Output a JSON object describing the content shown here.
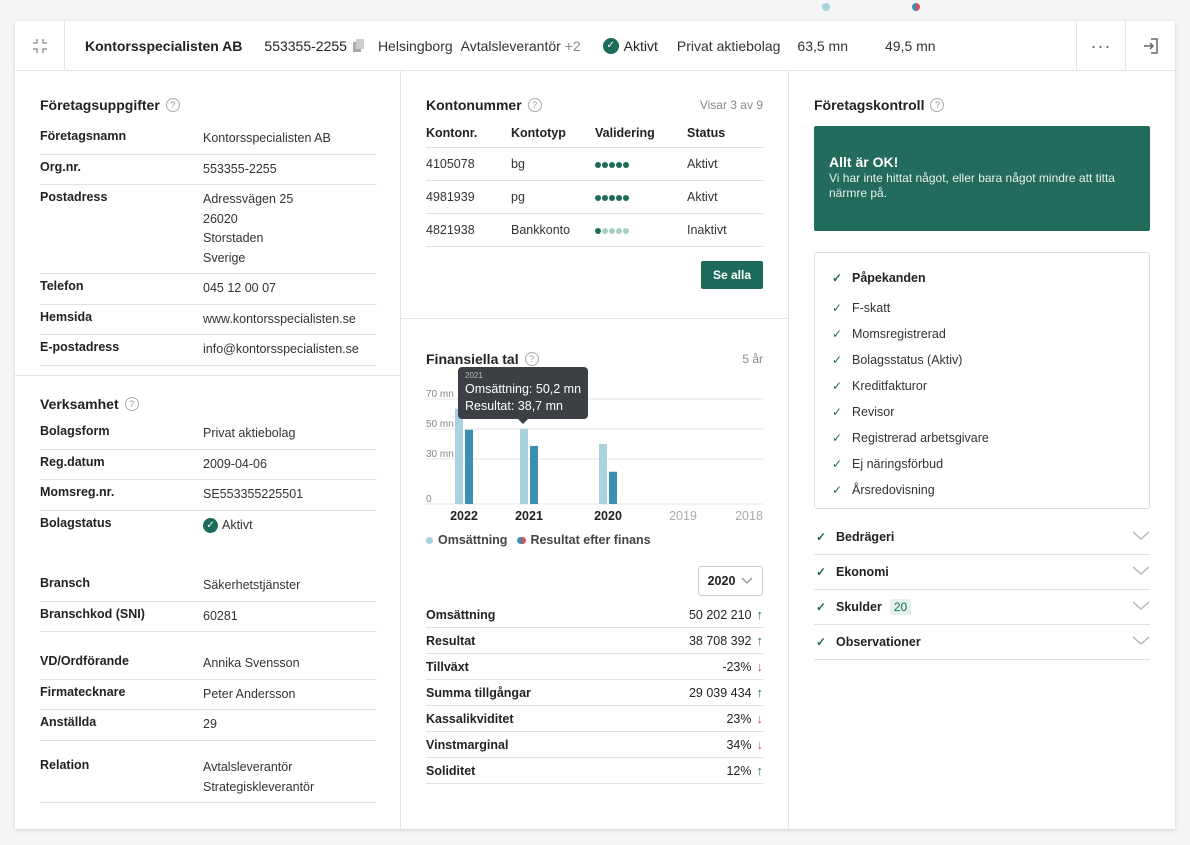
{
  "header": {
    "company_name": "Kontorsspecialisten AB",
    "org_nr": "553355-2255",
    "city": "Helsingborg",
    "relation": "Avtalsleverantör",
    "relation_more": "+2",
    "status": "Aktivt",
    "company_form": "Privat aktiebolag",
    "revenue": "63,5 mn",
    "result": "49,5 mn"
  },
  "colors": {
    "brand": "#1d6b5a",
    "revenue_bar": "#a9d1de",
    "result_bar": "#3a8fb4",
    "negative": "#d0545f"
  },
  "company_info": {
    "title": "Företagsuppgifter",
    "rows": [
      {
        "k": "Företagsnamn",
        "v": "Kontorsspecialisten AB"
      },
      {
        "k": "Org.nr.",
        "v": "553355-2255"
      },
      {
        "k": "Postadress",
        "v": "Adressvägen 25\n26020\nStorstaden\nSverige"
      },
      {
        "k": "Telefon",
        "v": "045 12 00 07"
      },
      {
        "k": "Hemsida",
        "v": "www.kontorsspecialisten.se"
      },
      {
        "k": "E-postadress",
        "v": "info@kontorsspecialisten.se"
      }
    ]
  },
  "business": {
    "title": "Verksamhet",
    "rows_a": [
      {
        "k": "Bolagsform",
        "v": "Privat aktiebolag"
      },
      {
        "k": "Reg.datum",
        "v": "2009-04-06"
      },
      {
        "k": "Momsreg.nr.",
        "v": "SE553355225501"
      },
      {
        "k": "Bolagstatus",
        "v": "Aktivt"
      }
    ],
    "rows_b": [
      {
        "k": "Bransch",
        "v": "Säkerhetstjänster"
      },
      {
        "k": "Branschkod (SNI)",
        "v": "60281"
      }
    ],
    "rows_c": [
      {
        "k": "VD/Ordförande",
        "v": "Annika Svensson"
      },
      {
        "k": "Firmatecknare",
        "v": "Peter Andersson"
      },
      {
        "k": "Anställda",
        "v": "29"
      }
    ],
    "rows_d": [
      {
        "k": "Relation",
        "v": "Avtalsleverantör\nStrategiskleverantör"
      }
    ]
  },
  "accounts": {
    "title": "Kontonummer",
    "count_label": "Visar 3 av 9",
    "headers": [
      "Kontonr.",
      "Kontotyp",
      "Validering",
      "Status"
    ],
    "rows": [
      {
        "nr": "4105078",
        "type": "bg",
        "validation": 5,
        "status": "Aktivt"
      },
      {
        "nr": "4981939",
        "type": "pg",
        "validation": 5,
        "status": "Aktivt"
      },
      {
        "nr": "4821938",
        "type": "Bankkonto",
        "validation": 1,
        "status": "Inaktivt"
      }
    ],
    "see_all": "Se alla"
  },
  "financials": {
    "title": "Finansiella tal",
    "period_label": "5 år",
    "tooltip": {
      "year": "2021",
      "revenue": "Omsättning: 50,2 mn",
      "result": "Resultat: 38,7 mn"
    },
    "legend": {
      "revenue": "Omsättning",
      "result": "Resultat efter finans"
    },
    "selected_year": "2020",
    "rows": [
      {
        "k": "Omsättning",
        "v": "50 202 210",
        "trend": "up"
      },
      {
        "k": "Resultat",
        "v": "38 708 392",
        "trend": "up"
      },
      {
        "k": "Tillväxt",
        "v": "-23%",
        "trend": "down"
      },
      {
        "k": "Summa tillgångar",
        "v": "29 039 434",
        "trend": "up"
      },
      {
        "k": "Kassalikviditet",
        "v": "23%",
        "trend": "down"
      },
      {
        "k": "Vinstmarginal",
        "v": "34%",
        "trend": "down"
      },
      {
        "k": "Soliditet",
        "v": "12%",
        "trend": "up"
      }
    ]
  },
  "chart_data": {
    "type": "bar",
    "categories": [
      "2022",
      "2021",
      "2020",
      "2019",
      "2018"
    ],
    "series": [
      {
        "name": "Omsättning",
        "values": [
          63.5,
          50.2,
          40,
          null,
          null
        ]
      },
      {
        "name": "Resultat efter finans",
        "values": [
          49.5,
          38.7,
          21.5,
          null,
          null
        ]
      }
    ],
    "y_ticks": [
      "0",
      "30 mn",
      "50 mn",
      "70 mn"
    ],
    "ylim": [
      0,
      80
    ],
    "legend": "bottom",
    "grid": true
  },
  "company_check": {
    "title": "Företagskontroll",
    "ok_title": "Allt är OK!",
    "ok_text": "Vi har inte hittat något, eller bara något mindre att titta närmre på.",
    "remarks_title": "Påpekanden",
    "remarks": [
      "F-skatt",
      "Momsregistrerad",
      "Bolagsstatus (Aktiv)",
      "Kreditfakturor",
      "Revisor",
      "Registrerad arbetsgivare",
      "Ej näringsförbud",
      "Årsredovisning"
    ],
    "sections": [
      {
        "label": "Bedrägeri",
        "badge": ""
      },
      {
        "label": "Ekonomi",
        "badge": ""
      },
      {
        "label": "Skulder",
        "badge": "20"
      },
      {
        "label": "Observationer",
        "badge": ""
      }
    ]
  }
}
